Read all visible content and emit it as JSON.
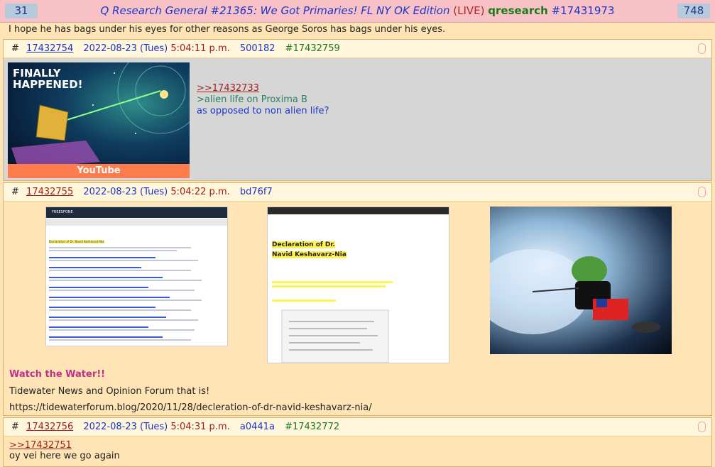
{
  "topbar": {
    "left_count": "31",
    "title": "Q Research General #21365: We Got Primaries! FL NY OK Edition",
    "live": "(LIVE)",
    "board": "qresearch",
    "thread_num": "#17431973",
    "right_count": "748"
  },
  "prev_post_tail": "I hope he has bags under his eyes for other reasons as George Soros has bags under his eyes.",
  "posts": [
    {
      "hash": "#",
      "num": "17432754",
      "date": "2022-08-23 (Tues)",
      "time": "5:04:11 p.m.",
      "id": "500182",
      "reply": "#17432759",
      "thumb": {
        "text1": "FINALLY",
        "text2": "HAPPENED!",
        "footer": "YouTube"
      },
      "quote_link": ">>17432733",
      "greentext": ">alien life on Proxima B",
      "body": "as opposed to non alien life?"
    },
    {
      "hash": "#",
      "num": "17432755",
      "date": "2022-08-23 (Tues)",
      "time": "5:04:22 p.m.",
      "id": "bd76f7",
      "thumb_a": {
        "brand": "FREESPONE",
        "heading": "Declaration of Dr. Navid Keshavarz-Nia"
      },
      "thumb_b": {
        "heading1": "Declaration of Dr.",
        "heading2": "Navid Keshavarz-Nia"
      },
      "headline": "Watch the Water!!",
      "line2": "Tidewater News and Opinion Forum that is!",
      "url": "https://tidewaterforum.blog/2020/11/28/decleration-of-dr-navid-keshavarz-nia/"
    },
    {
      "hash": "#",
      "num": "17432756",
      "date": "2022-08-23 (Tues)",
      "time": "5:04:31 p.m.",
      "id": "a0441a",
      "reply": "#17432772",
      "quote_link": ">>17432751",
      "body": "oy vei here we go again"
    }
  ],
  "colors": {
    "topbar": "#f7c1c6",
    "page_bg": "#ffe4b5",
    "post_head_bg": "#fff6dc",
    "link_red": "#a02020",
    "link_blue": "#1b36c9",
    "headline": "#c0308a"
  }
}
